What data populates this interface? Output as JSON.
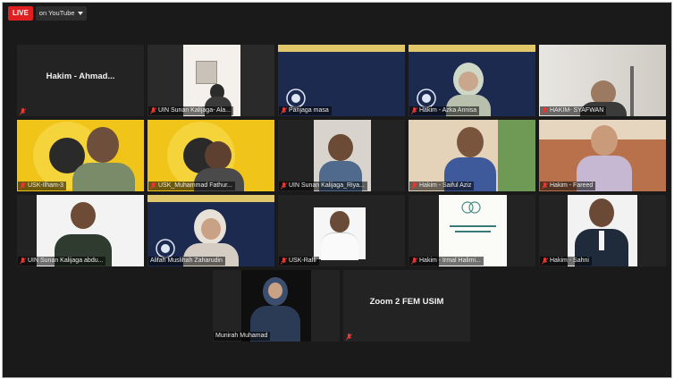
{
  "topbar": {
    "live_label": "LIVE",
    "stream_label": "on YouTube",
    "dropdown_icon": "caret-down-icon"
  },
  "colors": {
    "live": "#e02020",
    "tile_bg": "#232323",
    "active_outline": "#b9e64a",
    "mic_muted": "#e53935"
  },
  "tiles": [
    {
      "name": "Hakim - Ahmad...",
      "label": "",
      "type": "name-only",
      "muted": true
    },
    {
      "name": "UIN Sunan Kalijaga- Ala...",
      "label": "UIN Sunan Kalijaga- Ala...",
      "type": "video",
      "muted": true
    },
    {
      "name": "Panjaga masa",
      "label": "Panjaga masa",
      "type": "slide",
      "muted": true
    },
    {
      "name": "Hakim - Azka Annisa",
      "label": "Hakim - Azka Annisa",
      "type": "slide",
      "muted": true
    },
    {
      "name": "HAKIM- SYAFWAN",
      "label": "HAKIM- SYAFWAN",
      "type": "video",
      "muted": true
    },
    {
      "name": "USK-Ilham-3",
      "label": "USK-Ilham-3",
      "type": "video",
      "muted": true
    },
    {
      "name": "USK_Muhammad Fathur...",
      "label": "USK_Muhammad Fathur...",
      "type": "video",
      "muted": true
    },
    {
      "name": "UIN Sunan Kalijaga_Riya...",
      "label": "UIN Sunan Kalijaga_Riya...",
      "type": "video",
      "muted": true
    },
    {
      "name": "Hakim - Saiful Aziz",
      "label": "Hakim - Saiful Aziz",
      "type": "video",
      "muted": true
    },
    {
      "name": "Hakim - Fareed",
      "label": "Hakim - Fareed",
      "type": "video",
      "muted": true
    },
    {
      "name": "UIN Sunan Kalijaga abdu...",
      "label": "UIN Sunan Kalijaga abdu...",
      "type": "video",
      "muted": true
    },
    {
      "name": "Alifah Muslihah Zaharudin",
      "label": "Alifah Muslihah Zaharudin",
      "type": "slide",
      "muted": false,
      "active": true
    },
    {
      "name": "USK-Rafli",
      "label": "USK-Rafli",
      "type": "video",
      "muted": true
    },
    {
      "name": "Hakim - Irmal Halimi...",
      "label": "Hakim - Irmal Halimi...",
      "type": "video",
      "muted": true
    },
    {
      "name": "Hakim - Sahni",
      "label": "Hakim - Sahni",
      "type": "video",
      "muted": true
    },
    {
      "name": "Munirah Muhamad",
      "label": "Munirah Muhamad",
      "type": "video",
      "muted": false
    },
    {
      "name": "Zoom 2 FEM USIM",
      "label": "",
      "type": "name-only",
      "muted": true
    }
  ]
}
